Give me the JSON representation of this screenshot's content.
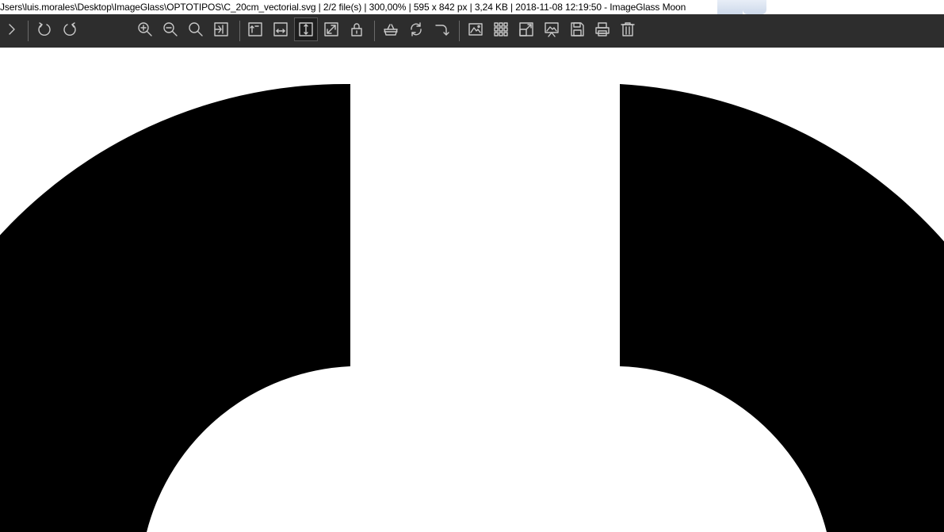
{
  "window": {
    "title": "Jsers\\luis.morales\\Desktop\\ImageGlass\\OPTOTIPOS\\C_20cm_vectorial.svg  |  2/2 file(s)  |  300,00%  |  595 x 842 px  |  3,24 KB  |  2018-11-08 12:19:50  - ImageGlass Moon"
  },
  "toolbar": {
    "buttons": [
      {
        "name": "expand-menu",
        "icon": "chevron-right-icon"
      },
      {
        "name": "rotate-left",
        "icon": "rotate-left-icon"
      },
      {
        "name": "rotate-right",
        "icon": "rotate-right-icon"
      },
      {
        "name": "zoom-in",
        "icon": "zoom-in-icon"
      },
      {
        "name": "zoom-out",
        "icon": "zoom-out-icon"
      },
      {
        "name": "actual-size",
        "icon": "magnifier-icon"
      },
      {
        "name": "auto-zoom",
        "icon": "auto-zoom-icon"
      },
      {
        "name": "scale-to-width",
        "icon": "scale-width-icon"
      },
      {
        "name": "scale-to-fit",
        "icon": "scale-fit-icon"
      },
      {
        "name": "scale-to-height",
        "icon": "scale-height-icon",
        "active": true
      },
      {
        "name": "scale-to-fill",
        "icon": "scale-fill-icon"
      },
      {
        "name": "lock-zoom",
        "icon": "lock-icon"
      },
      {
        "name": "checkered-background",
        "icon": "basket-icon"
      },
      {
        "name": "refresh",
        "icon": "refresh-icon"
      },
      {
        "name": "goto-image",
        "icon": "goto-icon"
      },
      {
        "name": "thumbnail-bar",
        "icon": "image-icon"
      },
      {
        "name": "thumbnail-grid",
        "icon": "grid-icon"
      },
      {
        "name": "full-screen",
        "icon": "fullscreen-icon"
      },
      {
        "name": "slideshow",
        "icon": "slideshow-icon"
      },
      {
        "name": "save",
        "icon": "save-icon"
      },
      {
        "name": "print",
        "icon": "print-icon"
      },
      {
        "name": "delete",
        "icon": "trash-icon"
      }
    ]
  },
  "colors": {
    "toolbar_bg": "#2d2d2d",
    "icon": "#c8c8c8",
    "canvas_bg": "#ffffff",
    "shape": "#000000"
  }
}
